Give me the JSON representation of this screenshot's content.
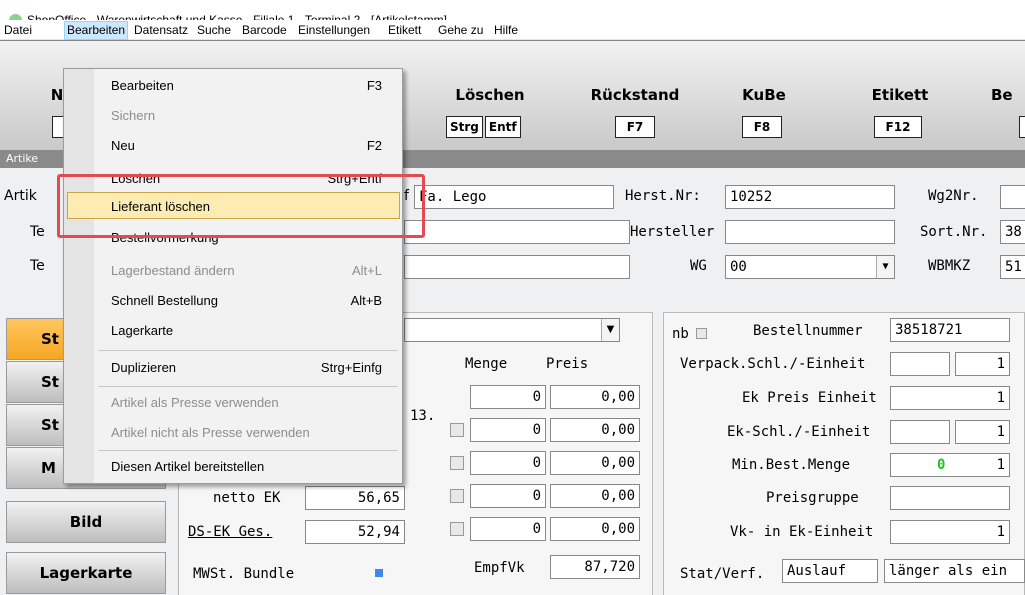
{
  "window": {
    "title": "ShopOffice - Warenwirtschaft und Kasse - Filiale 1 - Terminal 2 - [Artikelstamm]"
  },
  "menubar": [
    "Datei",
    "Bearbeiten",
    "Datensatz",
    "Suche",
    "Barcode",
    "Einstellungen",
    "Etikett",
    "Gehe zu",
    "Hilfe"
  ],
  "toolbar": {
    "partial_left_title": "N",
    "buttons": [
      {
        "label": "Löschen",
        "keys": [
          "Strg",
          "Entf"
        ]
      },
      {
        "label": "Rückstand",
        "keys": [
          "F7"
        ]
      },
      {
        "label": "KuBe",
        "keys": [
          "F8"
        ]
      },
      {
        "label": "Etikett",
        "keys": [
          "F12"
        ]
      },
      {
        "label": "Be",
        "keys": [
          ""
        ]
      }
    ]
  },
  "section": {
    "label": "Artike"
  },
  "form": {
    "artikel_label": "Artik",
    "supplier_suffix": "f",
    "supplier_value": "Fa. Lego",
    "te1_label": "Te",
    "te2_label": "Te",
    "herst_nr_label": "Herst.Nr:",
    "herst_nr_value": "10252",
    "hersteller_label": "Hersteller",
    "hersteller_value": "",
    "wg_label": "WG",
    "wg_value": "00",
    "wg2nr_label": "Wg2Nr.",
    "wg2nr_value": "",
    "sortnr_label": "Sort.Nr.",
    "sortnr_value": "38",
    "wbmkz_label": "WBMKZ",
    "wbmkz_value": "51"
  },
  "nav": [
    "St",
    "St",
    "St",
    "M",
    "Bild",
    "Lagerkarte"
  ],
  "mid": {
    "col_menge": "Menge",
    "col_preis": "Preis",
    "rows": [
      {
        "menge": "0",
        "preis": "0,00"
      },
      {
        "menge": "0",
        "preis": "0,00"
      },
      {
        "menge": "0",
        "preis": "0,00"
      },
      {
        "menge": "0",
        "preis": "0,00"
      },
      {
        "menge": "0",
        "preis": "0,00"
      }
    ],
    "partial_num": "13.",
    "netto_ek_label": "netto EK",
    "netto_ek_value": "56,65",
    "ds_ek_label": "DS-EK Ges.",
    "ds_ek_value": "52,94",
    "mwst_label": "MWSt. Bundle",
    "empfvk_label": "EmpfVk",
    "empfvk_value": "87,720"
  },
  "right": {
    "nb_label": "nb",
    "bestellnr_label": "Bestellnummer",
    "bestellnr_value": "38518721",
    "verpack_label": "Verpack.Schl./-Einheit",
    "verpack_value": "1",
    "ekpreis_label": "Ek Preis Einheit",
    "ekpreis_value": "1",
    "ekschl_label": "Ek-Schl./-Einheit",
    "ekschl_value": "1",
    "minbest_label": "Min.Best.Menge",
    "minbest_zero": "0",
    "minbest_value": "1",
    "preisgruppe_label": "Preisgruppe",
    "vkek_label": "Vk- in Ek-Einheit",
    "vkek_value": "1",
    "stat_label": "Stat/Verf.",
    "stat_value": "Auslauf",
    "stat_extra": "länger als ein"
  },
  "dropdown": {
    "items": [
      {
        "label": "Bearbeiten",
        "shortcut": "F3",
        "disabled": false
      },
      {
        "label": "Sichern",
        "shortcut": "",
        "disabled": true
      },
      {
        "label": "Neu",
        "shortcut": "F2",
        "disabled": false
      },
      {
        "label": "Löschen",
        "shortcut": "Strg+Entf",
        "disabled": false
      },
      {
        "label": "Lieferant löschen",
        "shortcut": "",
        "disabled": false,
        "highlighted": true
      },
      {
        "label": "Bestellvormerkung",
        "shortcut": "",
        "disabled": false
      },
      {
        "label": "Lagerbestand ändern",
        "shortcut": "Alt+L",
        "disabled": true
      },
      {
        "label": "Schnell Bestellung",
        "shortcut": "Alt+B",
        "disabled": false
      },
      {
        "label": "Lagerkarte",
        "shortcut": "",
        "disabled": false
      },
      {
        "label": "Duplizieren",
        "shortcut": "Strg+Einfg",
        "disabled": false
      },
      {
        "label": "Artikel als Presse verwenden",
        "shortcut": "",
        "disabled": true
      },
      {
        "label": "Artikel nicht als Presse verwenden",
        "shortcut": "",
        "disabled": true
      },
      {
        "label": "Diesen Artikel bereitstellen",
        "shortcut": "",
        "disabled": false
      }
    ]
  },
  "colors": {
    "highlight_fill": "#fcecb2",
    "annotation_red": "#e34a51",
    "active_nav": "#f5a623",
    "green_zero": "#22c322"
  }
}
